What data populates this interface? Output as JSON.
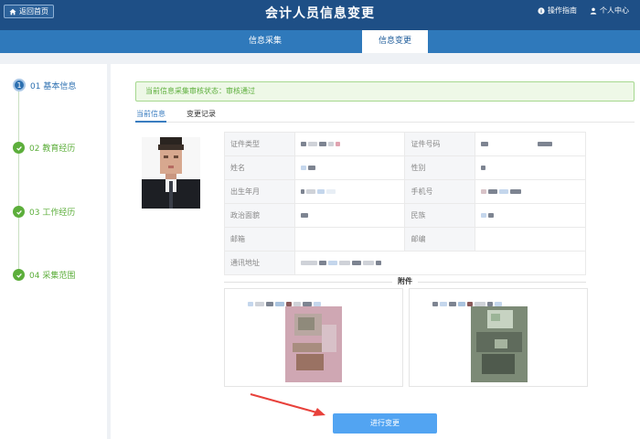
{
  "header": {
    "back_label": "返回首页",
    "title": "会计人员信息变更",
    "guide_label": "操作指南",
    "user_label": "个人中心"
  },
  "tabs": [
    {
      "label": "信息采集",
      "active": false
    },
    {
      "label": "信息变更",
      "active": true
    }
  ],
  "steps": [
    {
      "num": "1",
      "label": "01 基本信息",
      "state": "current"
    },
    {
      "num": "",
      "label": "02 教育经历",
      "state": "done"
    },
    {
      "num": "",
      "label": "03 工作经历",
      "state": "done"
    },
    {
      "num": "",
      "label": "04 采集范围",
      "state": "done"
    }
  ],
  "alert": "当前信息采集审核状态：审核通过",
  "subtabs": {
    "current": "当前信息",
    "history": "变更记录"
  },
  "info_labels": {
    "id_type": "证件类型",
    "id_number": "证件号码",
    "name": "姓名",
    "gender": "性别",
    "birth": "出生年月",
    "phone": "手机号",
    "political": "政治面貌",
    "ethnicity": "民族",
    "email": "邮箱",
    "postcode": "邮编",
    "address": "通讯地址"
  },
  "attachments_title": "附件",
  "change_button": "进行变更",
  "colors": {
    "header_bg": "#1e4f86",
    "tabbar_bg": "#2f79bb",
    "accent_blue": "#3a7dc0",
    "success_green": "#5cae3b",
    "button_blue": "#52a4f2",
    "arrow_red": "#e8413b"
  },
  "icons": {
    "back": "home-icon",
    "guide": "info-icon",
    "user": "user-icon",
    "step_done": "check-icon"
  }
}
